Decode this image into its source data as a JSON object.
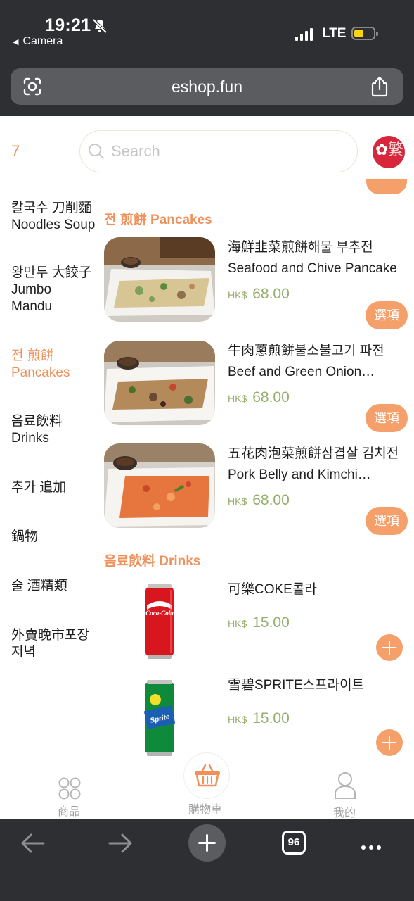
{
  "status_bar": {
    "time": "19:21",
    "back_label": "Camera",
    "network": "LTE",
    "icons": [
      "bell-slash-icon",
      "signal-icon",
      "battery-icon"
    ]
  },
  "browser": {
    "url": "eshop.fun",
    "tab_count": "96",
    "icons": [
      "lens-icon",
      "share-icon",
      "back-arrow-icon",
      "forward-arrow-icon",
      "new-tab-icon",
      "tabs-icon",
      "more-icon"
    ]
  },
  "header": {
    "count": "7",
    "search_placeholder": "Search",
    "language_label": "繁"
  },
  "categories": [
    {
      "line1": "칼국수 刀削麵",
      "line2": "Noodles Soup"
    },
    {
      "line1": "왕만두 大餃子",
      "line2": "Jumbo",
      "line3": "Mandu"
    },
    {
      "line1": "전 煎餅",
      "line2": "Pancakes"
    },
    {
      "line1": "음료飲料",
      "line2": "Drinks"
    },
    {
      "line1": "추가 追加"
    },
    {
      "line1": "鍋物"
    },
    {
      "line1": "술 酒精類"
    },
    {
      "line1": "外賣晚市포장",
      "line2": "저녁"
    }
  ],
  "sections": {
    "pancakes": "전 煎餅 Pancakes",
    "drinks": "음료飲料 Drinks"
  },
  "pancakes": [
    {
      "name": "海鮮韭菜煎餅해물 부추전",
      "name_en": "Seafood and Chive Pancake",
      "currency": "HK$",
      "price": "68.00",
      "button": "選項"
    },
    {
      "name": "牛肉蔥煎餅불소불고기 파전",
      "name_en": "Beef and Green Onion…",
      "currency": "HK$",
      "price": "68.00",
      "button": "選項"
    },
    {
      "name": "五花肉泡菜煎餅삼겹살 김치전",
      "name_en": "Pork Belly and Kimchi…",
      "currency": "HK$",
      "price": "68.00",
      "button": "選項"
    }
  ],
  "drinks": [
    {
      "name": "可樂COKE콜라",
      "currency": "HK$",
      "price": "15.00",
      "brand": "Coca-Cola"
    },
    {
      "name": "雪碧SPRITE스프라이트",
      "currency": "HK$",
      "price": "15.00",
      "brand": "Sprite"
    }
  ],
  "bottom_nav": {
    "products": "商品",
    "cart": "購物車",
    "mine": "我的"
  },
  "colors": {
    "accent": "#f0915b",
    "button": "#f5a06a",
    "price": "#94ad6a",
    "browser_chrome": "#2d2f32"
  }
}
